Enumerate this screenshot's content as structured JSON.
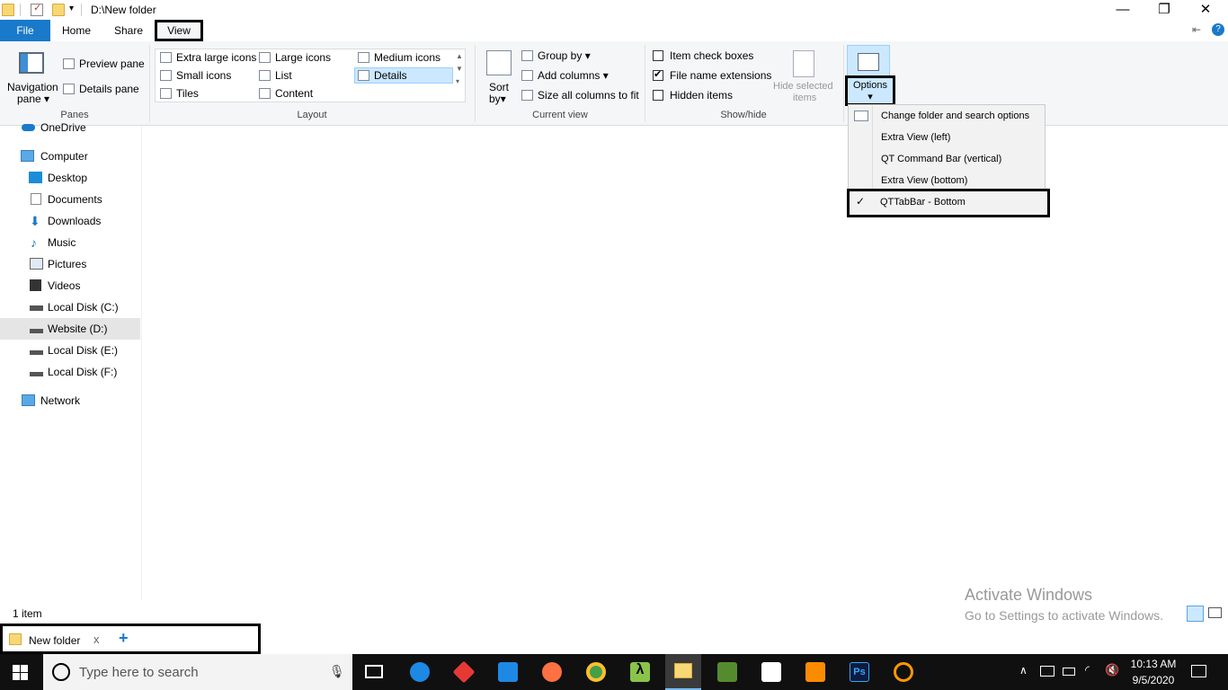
{
  "window": {
    "path": "D:\\New folder"
  },
  "tabs": {
    "file": "File",
    "home": "Home",
    "share": "Share",
    "view": "View"
  },
  "ribbon": {
    "panes": {
      "navigation_pane": "Navigation",
      "navigation_pane2": "pane",
      "preview_pane": "Preview pane",
      "details_pane": "Details pane",
      "label": "Panes"
    },
    "layout": {
      "items": [
        "Extra large icons",
        "Large icons",
        "Medium icons",
        "Small icons",
        "List",
        "Details",
        "Tiles",
        "Content"
      ],
      "label": "Layout"
    },
    "current_view": {
      "sort_by": "Sort",
      "sort_by2": "by",
      "group_by": "Group by",
      "add_columns": "Add columns",
      "size_columns": "Size all columns to fit",
      "label": "Current view"
    },
    "show_hide": {
      "item_check_boxes": "Item check boxes",
      "file_name_extensions": "File name extensions",
      "hidden_items": "Hidden items",
      "hide_selected": "Hide selected",
      "hide_selected2": "items",
      "label": "Show/hide"
    },
    "options": "Options"
  },
  "options_menu": {
    "items": [
      "Change folder and search options",
      "Extra View (left)",
      "QT Command Bar (vertical)",
      "Extra View (bottom)",
      "QTTabBar - Bottom"
    ]
  },
  "nav": {
    "items": [
      "OneDrive",
      "Computer",
      "Desktop",
      "Documents",
      "Downloads",
      "Music",
      "Pictures",
      "Videos",
      "Local Disk (C:)",
      "Website (D:)",
      "Local Disk (E:)",
      "Local Disk (F:)",
      "Network"
    ]
  },
  "status": {
    "count": "1 item"
  },
  "watermark": {
    "title": "Activate Windows",
    "subtitle": "Go to Settings to activate Windows."
  },
  "qttab": {
    "tab_label": "New folder",
    "close": "x",
    "add": "+"
  },
  "taskbar": {
    "search_placeholder": "Type here to search",
    "time": "10:13 AM",
    "date": "9/5/2020"
  },
  "colors": {
    "accent": "#1979ca",
    "highlight": "#cce8ff",
    "taskbar": "#101010"
  }
}
